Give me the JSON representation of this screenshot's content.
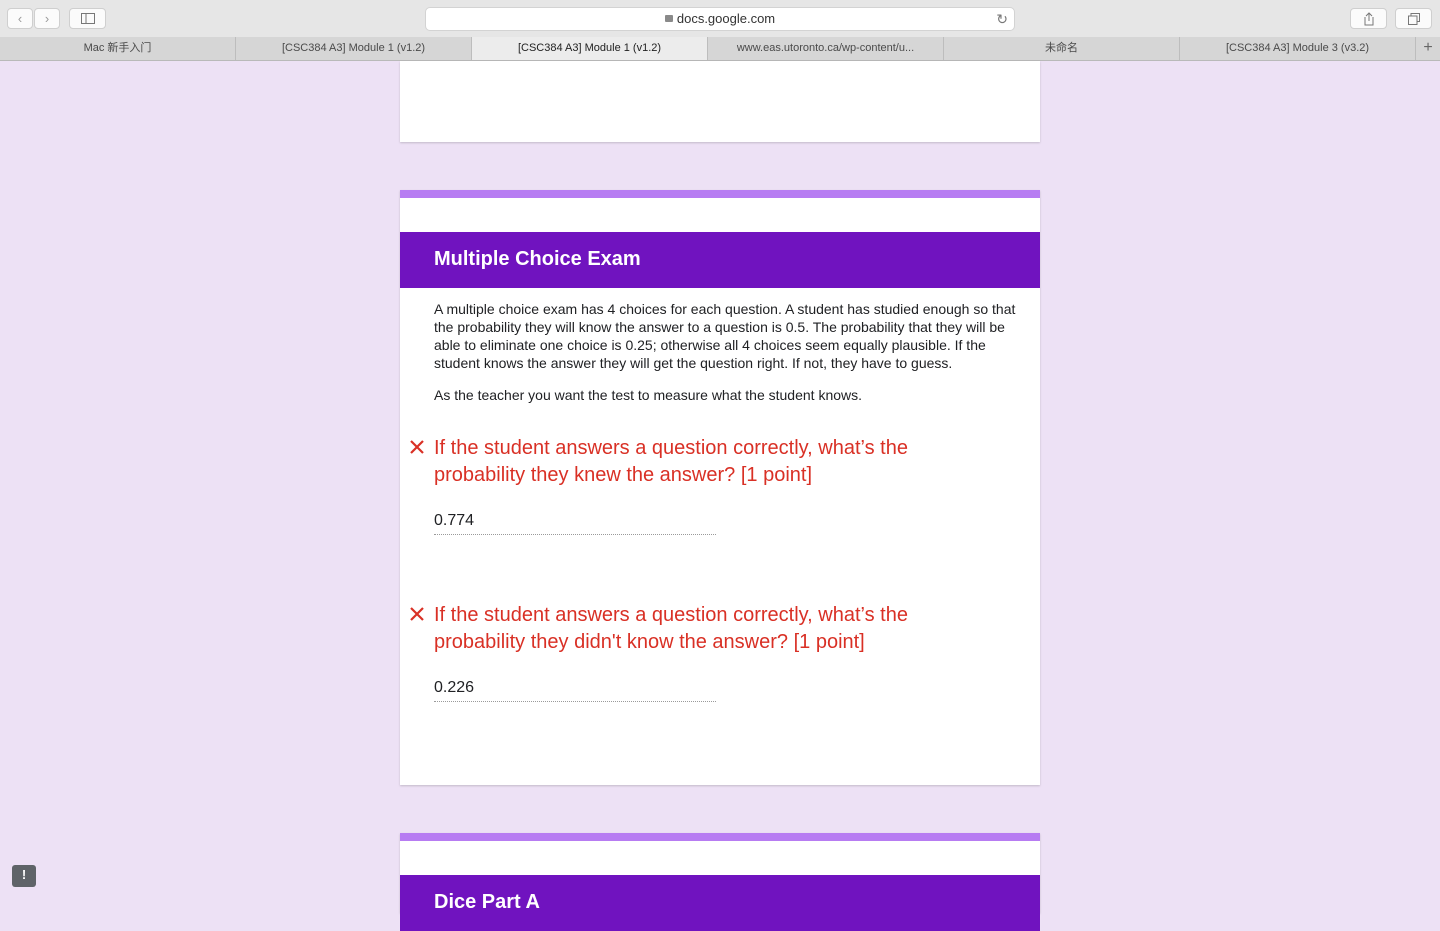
{
  "browser": {
    "url": "docs.google.com",
    "tabs": [
      {
        "label": "Mac 新手入门"
      },
      {
        "label": "[CSC384 A3] Module 1 (v1.2)"
      },
      {
        "label": "[CSC384 A3] Module 1 (v1.2)"
      },
      {
        "label": "www.eas.utoronto.ca/wp-content/u..."
      },
      {
        "label": "未命名"
      },
      {
        "label": "[CSC384 A3] Module 3 (v3.2)"
      }
    ],
    "active_tab": 2,
    "icons": {
      "back": "chevron-left-icon",
      "forward": "chevron-right-icon",
      "sidebar": "sidebar-icon",
      "share": "share-icon",
      "tabs": "tab-overview-icon",
      "reload": "reload-icon",
      "lock": "lock-icon",
      "new_tab": "plus-icon"
    }
  },
  "section": {
    "title": "Multiple Choice Exam",
    "description": [
      "A multiple choice exam has 4 choices for each question. A student has studied enough so that the probability they will know the answer to a question is 0.5.  The probability that they will be able to eliminate one choice is 0.25; otherwise all 4 choices seem equally plausible. If the student knows the answer they will get the question right. If not, they have to guess.",
      "As the teacher you want the test to measure what the student knows."
    ],
    "questions": [
      {
        "text": "If the student answers a question correctly, what’s the probability they knew the answer? [1 point]",
        "answer": "0.774",
        "status": "incorrect"
      },
      {
        "text": "If the student answers a question correctly, what’s the probability they didn't know the answer? [1 point]",
        "answer": "0.226",
        "status": "incorrect"
      }
    ]
  },
  "next_section": {
    "title": "Dice Part A"
  },
  "colors": {
    "accent": "#b77cf2",
    "header": "#7013bf",
    "error": "#d93025",
    "background": "#ede1f5"
  }
}
